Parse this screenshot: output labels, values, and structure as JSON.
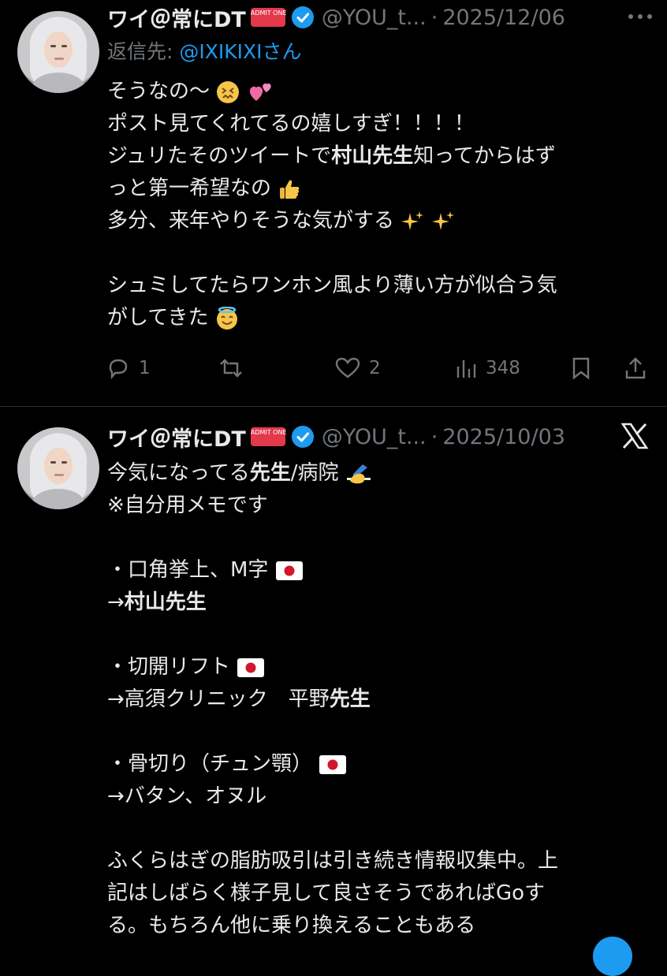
{
  "post1": {
    "display_name": "ワイ＠常にDT",
    "ticket_text": "ADMIT ONE",
    "handle": "@YOU_t...",
    "separator": "·",
    "date": "2025/12/06",
    "reply_label": "返信先: ",
    "reply_to": "@IXIKIXIさん",
    "lines": {
      "l1": "そうなの〜",
      "l2": "ポスト見てくれてるの嬉しすぎ！！！！",
      "l3a": "ジュリたそのツイートで",
      "l3b": "村山先生",
      "l3c": "知ってからはず",
      "l4": "っと第一希望なの",
      "l5": "多分、来年やりそうな気がする",
      "l7": "シュミしてたらワンホン風より薄い方が似合う気",
      "l8": "がしてきた"
    },
    "actions": {
      "reply_count": "1",
      "like_count": "2",
      "views_count": "348"
    }
  },
  "post2": {
    "display_name": "ワイ＠常にDT",
    "ticket_text": "ADMIT ONE",
    "handle": "@YOU_t...",
    "separator": "·",
    "date": "2025/10/03",
    "lines": {
      "l1a": "今気になってる",
      "l1b": "先生",
      "l1c": "/病院",
      "l2": "※自分用メモです",
      "l4": "・口角挙上、M字",
      "l5a": "→",
      "l5b": "村山先生",
      "l7": "・切開リフト",
      "l8a": "→高須クリニック　平野",
      "l8b": "先生",
      "l10": "・骨切り（チュン顎）",
      "l11": "→バタン、オヌル",
      "l13": "ふくらはぎの脂肪吸引は引き続き情報収集中。上",
      "l14": "記はしばらく様子見して良さそうであればGoす",
      "l15": "る。もちろん他に乗り換えることもある"
    }
  },
  "colors": {
    "background": "#000000",
    "text": "#e7e9ea",
    "muted": "#71767b",
    "accent": "#1d9bf0",
    "divider": "#2f3336"
  },
  "icons": [
    "more-icon",
    "verified-badge-icon",
    "ticket-icon",
    "reply-icon",
    "repost-icon",
    "like-icon",
    "views-icon",
    "bookmark-icon",
    "share-icon",
    "x-logo-icon",
    "japan-flag-icon"
  ]
}
